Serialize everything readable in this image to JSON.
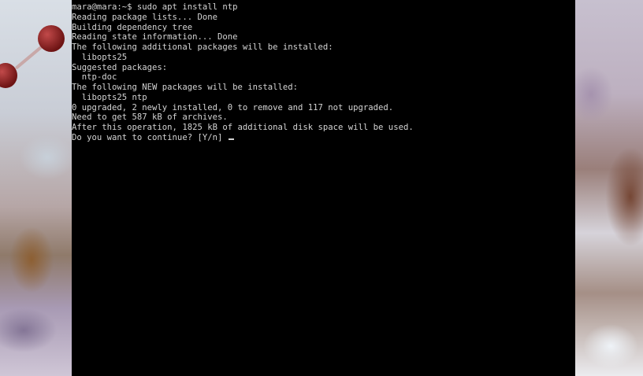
{
  "terminal": {
    "lines": [
      "mara@mara:~$ sudo apt install ntp",
      "Reading package lists... Done",
      "Building dependency tree",
      "Reading state information... Done",
      "The following additional packages will be installed:",
      "  libopts25",
      "Suggested packages:",
      "  ntp-doc",
      "The following NEW packages will be installed:",
      "  libopts25 ntp",
      "0 upgraded, 2 newly installed, 0 to remove and 117 not upgraded.",
      "Need to get 587 kB of archives.",
      "After this operation, 1825 kB of additional disk space will be used.",
      "Do you want to continue? [Y/n] "
    ],
    "foreground": "#d4d4d4",
    "background": "#000000"
  }
}
